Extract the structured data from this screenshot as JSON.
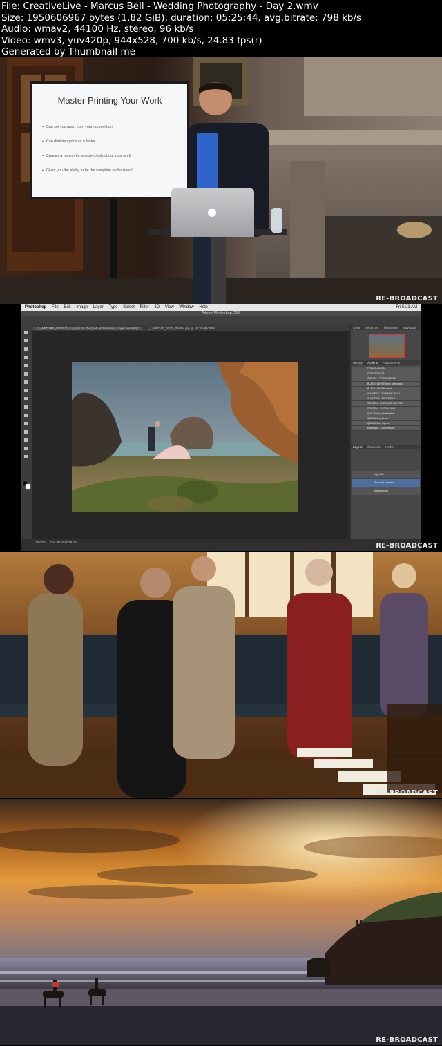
{
  "header": {
    "file": "File: CreativeLive - Marcus Bell - Wedding Photography - Day 2.wmv",
    "size": "Size: 1950606967 bytes (1.82 GiB), duration: 05:25:44, avg.bitrate: 798 kb/s",
    "audio": "Audio: wmav2, 44100 Hz, stereo, 96 kb/s",
    "video": "Video: wmv3, yuv420p, 944x528, 700 kb/s, 24.83 fps(r)",
    "generator": "Generated by Thumbnail me"
  },
  "watermark": "RE-BROADCAST",
  "frame1": {
    "slide_title": "Master Printing Your Work",
    "bullets": [
      "Can set you apart from your competition",
      "Can diminish price as a factor",
      "Creates a reason for people to talk about your work",
      "Gives you the ability to be the complete professional"
    ],
    "laptop_logo": ""
  },
  "frame2": {
    "menu": [
      "Photoshop",
      "File",
      "Edit",
      "Image",
      "Layer",
      "Type",
      "Select",
      "Filter",
      "3D",
      "View",
      "Window",
      "Help"
    ],
    "menu_right": "Fri 5:21 AM",
    "app_title": "Adobe Photoshop CS6",
    "doc_tabs": [
      "_1_WED1R0_0912071_0.jpg @ 16.7% (Soft and Warless, Layer Mask/8) *",
      "_1_WED10_0912_FINISH.jpg @ 16.7% (RGB/8)"
    ],
    "panel_tabs": [
      "History",
      "Actions",
      "Adjustments"
    ],
    "top_panel_tabs": [
      "Color",
      "Swatches",
      "Histogram",
      "Navigator"
    ],
    "actions": [
      "DODGE+BURN",
      "SOFT STYLER",
      "COLOR + PROCESSING",
      "BLACK+WHITE fixes with mask",
      "BLACK+WHITE detail",
      "SHARPEN - DYNAMIC_FULL",
      "SHARPEN - SELECTIVE",
      "SOFTEN - PORTRAIT PAINTER",
      "SOFTEN - GLOBAL 50%",
      "QUICKFlow_ProtPretties",
      "QUICKFlow_Bruce",
      "QUICKFlow_Opens",
      "Essentials - Conversions"
    ],
    "layers_tabs": [
      "Layers",
      "Channels",
      "Paths"
    ],
    "layers": [
      {
        "name": "Vignette",
        "selected": false
      },
      {
        "name": "Soft and Warless",
        "selected": true
      },
      {
        "name": "Background",
        "selected": false
      }
    ],
    "zoom": "16.67%",
    "doc_info": "Doc: 81.9M/159.2M"
  }
}
